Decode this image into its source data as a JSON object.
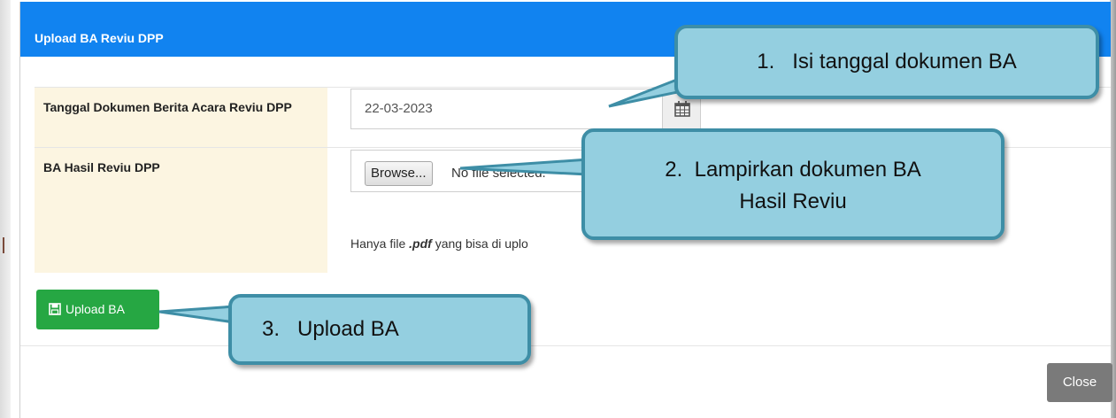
{
  "modal": {
    "title": "Upload BA Reviu DPP",
    "fields": [
      {
        "label": "Tanggal Dokumen Berita Acara Reviu DPP",
        "value": "22-03-2023"
      },
      {
        "label": "BA Hasil Reviu DPP",
        "browse_label": "Browse...",
        "file_status": "No file selected."
      }
    ],
    "help_prefix": "Hanya file ",
    "help_ext": ".pdf",
    "help_suffix": " yang bisa di uplo",
    "upload_label": "Upload BA",
    "close_label": "Close"
  },
  "callouts": [
    {
      "number": "1.",
      "text": "Isi tanggal dokumen BA"
    },
    {
      "number": "2.",
      "text": "Lampirkan dokumen BA",
      "text_line2": "Hasil Reviu"
    },
    {
      "number": "3.",
      "text": "Upload BA"
    }
  ],
  "icons": {
    "calendar": "calendar-icon",
    "save": "floppy-disk-icon"
  },
  "colors": {
    "header": "#1183f0",
    "label_bg": "#fcf5e1",
    "upload_button": "#26a743",
    "close_button": "#7a7a7a",
    "callout_fill": "#94cfe0",
    "callout_border": "#3e8ea6"
  }
}
